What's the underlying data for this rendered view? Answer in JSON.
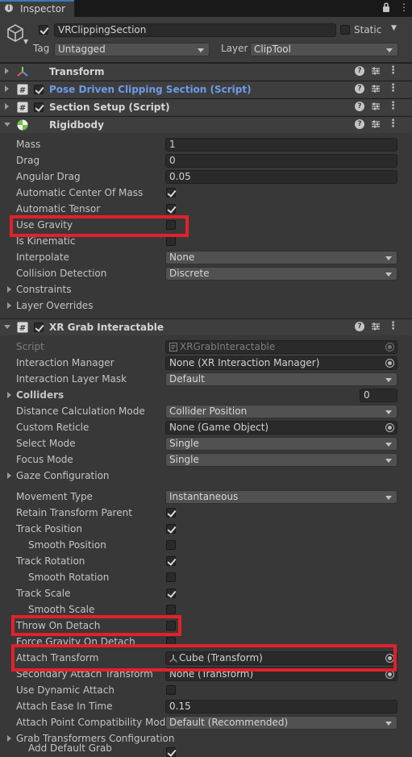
{
  "tab": {
    "label": "Inspector"
  },
  "header": {
    "name": "VRClippingSection",
    "static_label": "Static",
    "tag_label": "Tag",
    "tag_value": "Untagged",
    "layer_label": "Layer",
    "layer_value": "ClipTool"
  },
  "components": {
    "transform": "Transform",
    "pose": "Pose Driven Clipping Section (Script)",
    "section": "Section Setup (Script)",
    "rigidbody": "Rigidbody",
    "xrgrab": "XR Grab Interactable"
  },
  "rigidbody": {
    "mass_label": "Mass",
    "mass": "1",
    "drag_label": "Drag",
    "drag": "0",
    "angular_drag_label": "Angular Drag",
    "angular_drag": "0.05",
    "auto_com_label": "Automatic Center Of Mass",
    "auto_tensor_label": "Automatic Tensor",
    "use_gravity_label": "Use Gravity",
    "is_kinematic_label": "Is Kinematic",
    "interpolate_label": "Interpolate",
    "interpolate": "None",
    "collision_label": "Collision Detection",
    "collision": "Discrete",
    "constraints_label": "Constraints",
    "layer_overrides_label": "Layer Overrides"
  },
  "xr": {
    "script_label": "Script",
    "script": "XRGrabInteractable",
    "manager_label": "Interaction Manager",
    "manager": "None (XR Interaction Manager)",
    "layer_mask_label": "Interaction Layer Mask",
    "layer_mask": "Default",
    "colliders_label": "Colliders",
    "colliders_count": "0",
    "distance_label": "Distance Calculation Mode",
    "distance": "Collider Position",
    "reticle_label": "Custom Reticle",
    "reticle": "None (Game Object)",
    "select_label": "Select Mode",
    "select": "Single",
    "focus_label": "Focus Mode",
    "focus": "Single",
    "gaze_label": "Gaze Configuration",
    "movement_label": "Movement Type",
    "movement": "Instantaneous",
    "retain_label": "Retain Transform Parent",
    "track_pos_label": "Track Position",
    "smooth_pos_label": "Smooth Position",
    "track_rot_label": "Track Rotation",
    "smooth_rot_label": "Smooth Rotation",
    "track_scale_label": "Track Scale",
    "smooth_scale_label": "Smooth Scale",
    "throw_label": "Throw On Detach",
    "force_gravity_label": "Force Gravity On Detach",
    "attach_label": "Attach Transform",
    "attach": "Cube (Transform)",
    "secondary_label": "Secondary Attach Transform",
    "secondary": "None (Transform)",
    "dynamic_label": "Use Dynamic Attach",
    "ease_label": "Attach Ease In Time",
    "ease": "0.15",
    "compat_label": "Attach Point Compatibility Mode",
    "compat": "Default (Recommended)",
    "grab_transformers_label": "Grab Transformers Configuration",
    "add_default_label": "Add Default Grab"
  },
  "colors": {
    "highlight": "#e3202b",
    "link": "#6d9be8",
    "background": "#383838"
  }
}
